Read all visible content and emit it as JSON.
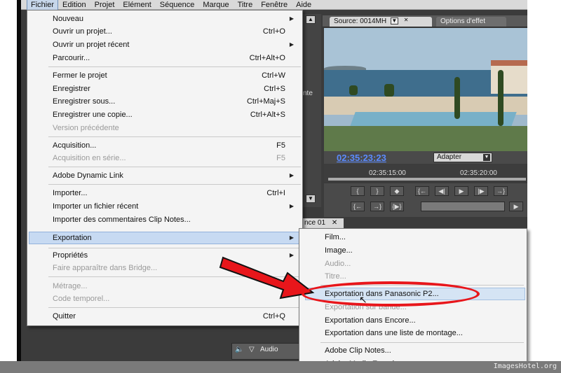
{
  "menubar": {
    "items": [
      "Fichier",
      "Edition",
      "Projet",
      "Elément",
      "Séquence",
      "Marque",
      "Titre",
      "Fenêtre",
      "Aide"
    ]
  },
  "file_menu": {
    "items": [
      {
        "label": "Nouveau",
        "shortcut": "",
        "submenu": true,
        "disabled": false
      },
      {
        "label": "Ouvrir un projet...",
        "shortcut": "Ctrl+O",
        "submenu": false,
        "disabled": false
      },
      {
        "label": "Ouvrir un projet récent",
        "shortcut": "",
        "submenu": true,
        "disabled": false
      },
      {
        "label": "Parcourir...",
        "shortcut": "Ctrl+Alt+O",
        "submenu": false,
        "disabled": false
      },
      {
        "label": "Fermer le projet",
        "shortcut": "Ctrl+W",
        "submenu": false,
        "disabled": false
      },
      {
        "label": "Enregistrer",
        "shortcut": "Ctrl+S",
        "submenu": false,
        "disabled": false
      },
      {
        "label": "Enregistrer sous...",
        "shortcut": "Ctrl+Maj+S",
        "submenu": false,
        "disabled": false
      },
      {
        "label": "Enregistrer une copie...",
        "shortcut": "Ctrl+Alt+S",
        "submenu": false,
        "disabled": false
      },
      {
        "label": "Version précédente",
        "shortcut": "",
        "submenu": false,
        "disabled": true
      },
      {
        "label": "Acquisition...",
        "shortcut": "F5",
        "submenu": false,
        "disabled": false
      },
      {
        "label": "Acquisition en série...",
        "shortcut": "F5",
        "submenu": false,
        "disabled": true
      },
      {
        "label": "Adobe Dynamic Link",
        "shortcut": "",
        "submenu": true,
        "disabled": false
      },
      {
        "label": "Importer...",
        "shortcut": "Ctrl+I",
        "submenu": false,
        "disabled": false
      },
      {
        "label": "Importer un fichier récent",
        "shortcut": "",
        "submenu": true,
        "disabled": false
      },
      {
        "label": "Importer des commentaires Clip Notes...",
        "shortcut": "",
        "submenu": false,
        "disabled": false
      },
      {
        "label": "Exportation",
        "shortcut": "",
        "submenu": true,
        "disabled": false
      },
      {
        "label": "Propriétés",
        "shortcut": "",
        "submenu": true,
        "disabled": false
      },
      {
        "label": "Faire apparaître dans Bridge...",
        "shortcut": "",
        "submenu": false,
        "disabled": true
      },
      {
        "label": "Métrage...",
        "shortcut": "",
        "submenu": false,
        "disabled": true
      },
      {
        "label": "Code temporel...",
        "shortcut": "",
        "submenu": false,
        "disabled": true
      },
      {
        "label": "Quitter",
        "shortcut": "Ctrl+Q",
        "submenu": false,
        "disabled": false
      }
    ]
  },
  "export_submenu": {
    "items": [
      {
        "label": "Film...",
        "disabled": false
      },
      {
        "label": "Image...",
        "disabled": false
      },
      {
        "label": "Audio...",
        "disabled": true
      },
      {
        "label": "Titre...",
        "disabled": true
      },
      {
        "label": "Exportation dans Panasonic P2...",
        "disabled": false
      },
      {
        "label": "Exportation sur bande...",
        "disabled": true
      },
      {
        "label": "Exportation dans Encore...",
        "disabled": false
      },
      {
        "label": "Exportation dans une liste de montage...",
        "disabled": false
      },
      {
        "label": "Adobe Clip Notes...",
        "disabled": false
      },
      {
        "label": "Adobe Media Encoder...",
        "disabled": false
      }
    ]
  },
  "source_panel": {
    "tab_source": "Source: 0014MH",
    "tab_options": "Options d'effet",
    "timecode": "02:35:23:23",
    "fit": "Adapter",
    "ruler_left": "02:35:15:00",
    "ruler_right": "02:35:20:00"
  },
  "sequence_tab": "nce 01",
  "audio_label": "Audio",
  "side_text": "nte",
  "watermark": "ImagesHotel.org",
  "annotation_colors": {
    "arrow": "#e8161b",
    "ellipse": "#e8161b"
  }
}
